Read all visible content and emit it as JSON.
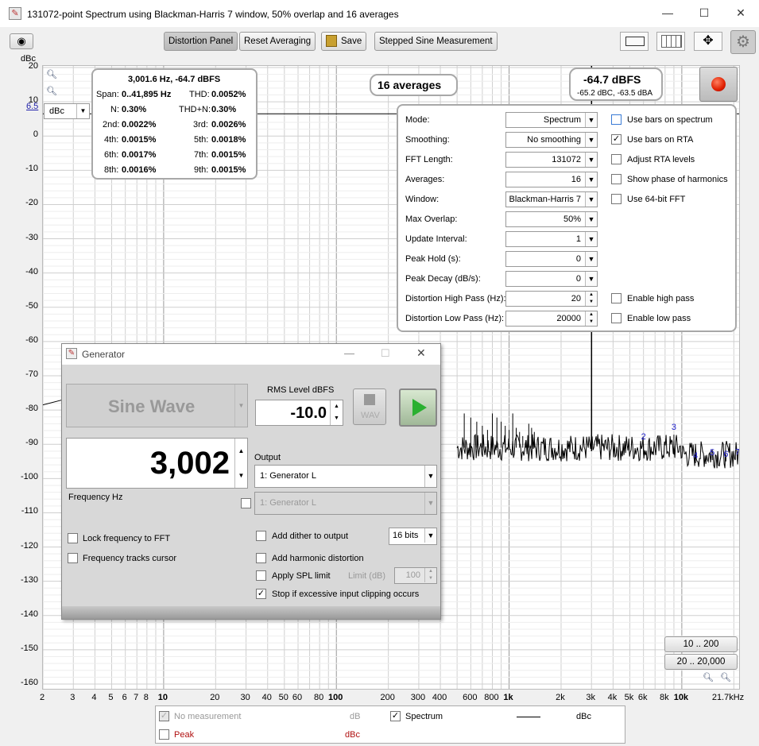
{
  "window": {
    "title": "131072-point Spectrum using Blackman-Harris 7 window, 50% overlap and 16 averages"
  },
  "toolbar": {
    "distortion_panel": "Distortion Panel",
    "reset_averaging": "Reset Averaging",
    "save": "Save",
    "stepped_sine": "Stepped Sine Measurement"
  },
  "axis": {
    "y_unit": "dBc",
    "y_ticks": [
      "20",
      "10",
      "0",
      "-10",
      "-20",
      "-30",
      "-40",
      "-50",
      "-60",
      "-70",
      "-80",
      "-90",
      "-100",
      "-110",
      "-120",
      "-130",
      "-140",
      "-150",
      "-160"
    ],
    "x_ticks": [
      "2",
      "3",
      "4",
      "5",
      "6",
      "7",
      "8",
      "10",
      "20",
      "30",
      "40",
      "50",
      "60",
      "80",
      "100",
      "200",
      "300",
      "400",
      "600",
      "800",
      "1k",
      "2k",
      "3k",
      "4k",
      "5k",
      "6k",
      "8k",
      "10k",
      "21.7kHz"
    ],
    "offset_value": "6.5",
    "unit_select": "dBc"
  },
  "chart_data": {
    "type": "line",
    "title": "131072-point Spectrum using Blackman-Harris 7 window, 50% overlap and 16 averages",
    "xlabel": "",
    "ylabel": "dBc",
    "ylim": [
      -165,
      20
    ],
    "xlim": [
      2,
      21700
    ],
    "x_scale": "log",
    "series": [
      {
        "name": "Spectrum",
        "x": [
          3002,
          6000,
          9000,
          12000,
          15000,
          18000,
          21000
        ],
        "values": [
          0,
          -89.9,
          -87.2,
          -95.5,
          -94.6,
          -95,
          -94.5
        ]
      }
    ],
    "harmonic_labels": [
      "2",
      "3",
      "4",
      "5",
      "6",
      "7"
    ]
  },
  "readout": {
    "freq_line": "3,001.6 Hz, -64.7 dBFS",
    "span_label": "Span:",
    "span_value": "0..41,895 Hz",
    "thd_label": "THD:",
    "thd_value": "0.0052%",
    "n_label": "N:",
    "n_value": "0.30%",
    "thdn_label": "THD+N:",
    "thdn_value": "0.30%",
    "h2_label": "2nd:",
    "h2_value": "0.0022%",
    "h3_label": "3rd:",
    "h3_value": "0.0026%",
    "h4_label": "4th:",
    "h4_value": "0.0015%",
    "h5_label": "5th:",
    "h5_value": "0.0018%",
    "h6_label": "6th:",
    "h6_value": "0.0017%",
    "h7_label": "7th:",
    "h7_value": "0.0015%",
    "h8_label": "8th:",
    "h8_value": "0.0016%",
    "h9_label": "9th:",
    "h9_value": "0.0015%"
  },
  "averages_badge": "16 averages",
  "level": {
    "main": "-64.7 dBFS",
    "sub": "-65.2 dBC, -63.5 dBA"
  },
  "settings": {
    "mode_label": "Mode:",
    "mode_value": "Spectrum",
    "smoothing_label": "Smoothing:",
    "smoothing_value": "No  smoothing",
    "fft_label": "FFT Length:",
    "fft_value": "131072",
    "averages_label": "Averages:",
    "averages_value": "16",
    "window_label": "Window:",
    "window_value": "Blackman-Harris 7",
    "overlap_label": "Max Overlap:",
    "overlap_value": "50%",
    "update_label": "Update Interval:",
    "update_value": "1",
    "peakhold_label": "Peak Hold (s):",
    "peakhold_value": "0",
    "peakdecay_label": "Peak Decay (dB/s):",
    "peakdecay_value": "0",
    "hp_label": "Distortion High Pass (Hz):",
    "hp_value": "20",
    "lp_label": "Distortion Low Pass (Hz):",
    "lp_value": "20000",
    "cb_bars_spectrum": "Use bars on spectrum",
    "cb_bars_rta": "Use bars on RTA",
    "cb_adjust_rta": "Adjust RTA levels",
    "cb_phase": "Show phase of harmonics",
    "cb_64bit": "Use 64-bit FFT",
    "cb_highpass": "Enable high pass",
    "cb_lowpass": "Enable low pass"
  },
  "range_buttons": {
    "r1": "10 .. 200",
    "r2": "20 .. 20,000"
  },
  "generator": {
    "title": "Generator",
    "wave": "Sine Wave",
    "rms_label": "RMS Level dBFS",
    "rms_value": "-10.0",
    "wav_label": "WAV",
    "frequency": "3,002",
    "freq_label": "Frequency Hz",
    "output_label": "Output",
    "output_value": "1: Generator L",
    "output2_value": "1: Generator L",
    "lock_freq": "Lock frequency to FFT",
    "track_cursor": "Frequency tracks cursor",
    "dither": "Add dither to output",
    "bits": "16 bits",
    "harmonic": "Add harmonic distortion",
    "spl": "Apply SPL limit",
    "limit_label": "Limit (dB)",
    "limit_value": "100",
    "stop_clip": "Stop if excessive input clipping occurs"
  },
  "legend": {
    "no_measurement": "No measurement",
    "db": "dB",
    "spectrum": "Spectrum",
    "dbc": "dBc",
    "peak": "Peak",
    "peak_unit": "dBc"
  }
}
